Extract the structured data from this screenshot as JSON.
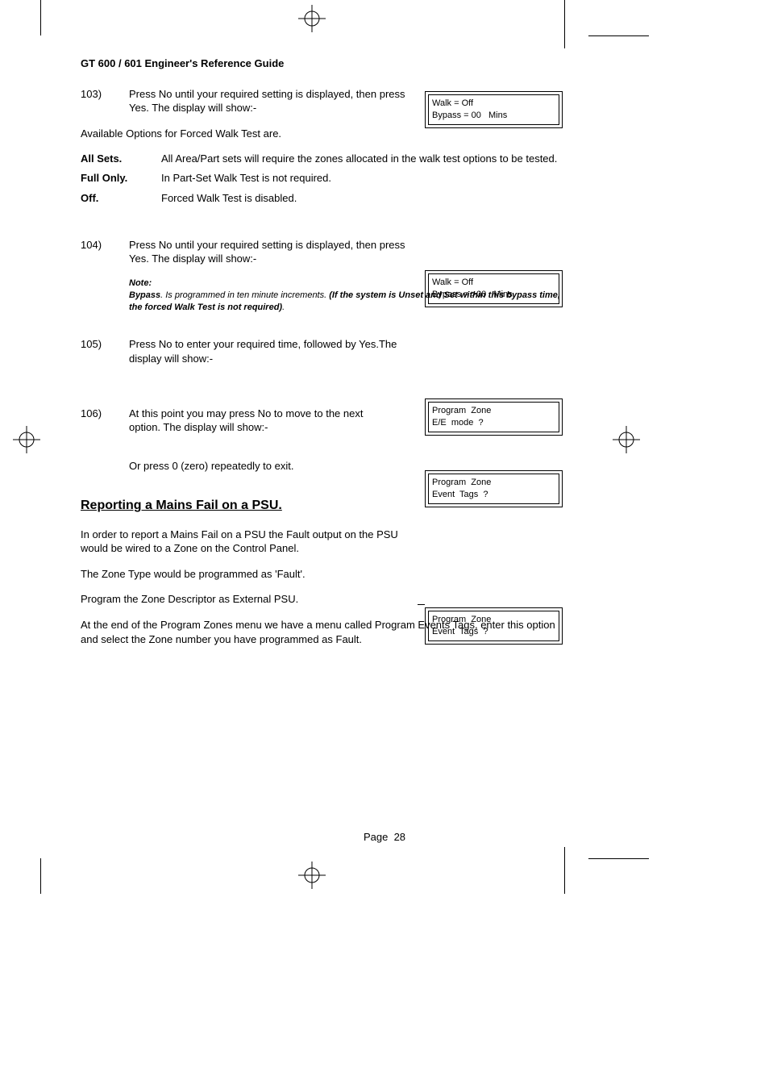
{
  "header": "GT 600 / 601 Engineer's Reference Guide",
  "steps": {
    "s103": {
      "num": "103)",
      "text": "Press No until your required setting is displayed, then press Yes. The display will show:-",
      "lcd": "Walk = Off\nBypass = 00   Mins"
    },
    "avail": "Available Options for Forced Walk Test are.",
    "opts": {
      "allsets": {
        "label": "All Sets.",
        "desc": "All Area/Part sets will require the zones allocated in the walk test options to be tested."
      },
      "fullonly": {
        "label": "Full Only.",
        "desc": "In Part-Set Walk Test is not required."
      },
      "off": {
        "label": "Off.",
        "desc": "Forced Walk Test is disabled."
      }
    },
    "s104": {
      "num": "104)",
      "text": "Press No until your required setting is displayed, then press Yes. The display will show:-",
      "lcd": "Walk = Off\nBypass = >00   Mins"
    },
    "note": {
      "label": "Note:",
      "lead": "Bypass",
      "rest": ". Is programmed in ten minute increments. ",
      "bold": "(If the system is Unset  and Set within this bypass time, the forced Walk Test is not required)",
      "end": "."
    },
    "s105": {
      "num": "105)",
      "text": "Press No to enter your required time, followed by Yes.The display will show:-",
      "lcd": "Program  Zone\nE/E  mode  ?"
    },
    "s106": {
      "num": "106)",
      "text": "At this point you may press No to move to the next option. The display will show:-",
      "lcd": "Program  Zone\nEvent  Tags  ?",
      "after": "Or press 0 (zero) repeatedly to exit."
    }
  },
  "section": {
    "title": "Reporting a Mains Fail on a PSU.",
    "p1": "In order to report a Mains Fail on a PSU the Fault output on the PSU would be wired to a Zone on the Control Panel.",
    "p2": "The Zone Type would be programmed as 'Fault'.",
    "p3": "Program the Zone Descriptor as External PSU.",
    "p4": "At the end of the Program Zones menu we have a menu called Program Events Tags, enter this option and select the Zone number you have programmed as Fault.",
    "lcd": "Program  Zone\nEvent  Tags  ?"
  },
  "footer": {
    "label": "Page",
    "num": "28"
  }
}
